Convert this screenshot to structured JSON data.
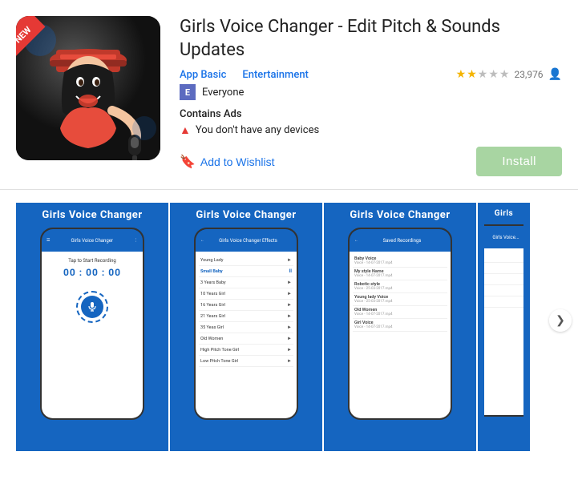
{
  "app": {
    "title": "Girls Voice Changer - Edit Pitch & Sounds Updates",
    "badge_new": "NEW",
    "category_primary": "App Basic",
    "category_secondary": "Entertainment",
    "rating_value": "2",
    "rating_count": "23,976",
    "rated": "Everyone",
    "rated_badge": "E",
    "contains_ads": "Contains Ads",
    "device_warning": "You don't have any devices",
    "add_wishlist": "Add to Wishlist",
    "install": "Install"
  },
  "screenshots": [
    {
      "title": "Girls Voice Changer",
      "type": "record",
      "tap_text": "Tap to Start Recording",
      "timer": "00 : 00 : 00",
      "nav_bar": "Girls Voice Changer"
    },
    {
      "title": "Girls Voice Changer",
      "type": "effects",
      "nav_bar": "Girls Voice Changer Effects",
      "effects": [
        {
          "name": "Young Lady",
          "play": "►"
        },
        {
          "name": "Small Baby",
          "play": "II",
          "highlighted": true
        },
        {
          "name": "3 Years Baby",
          "play": "►"
        },
        {
          "name": "10 Years Girl",
          "play": "►"
        },
        {
          "name": "16 Years Girl",
          "play": "►"
        },
        {
          "name": "21 Years Girl",
          "play": "►"
        },
        {
          "name": "35 Yeas Girl",
          "play": "►"
        },
        {
          "name": "Old Women",
          "play": "►"
        },
        {
          "name": "High Pitch Tone Girl",
          "play": "►"
        },
        {
          "name": "Low Pitch Tone Girl",
          "play": "►"
        }
      ]
    },
    {
      "title": "Girls Voice Changer",
      "type": "saved",
      "nav_bar": "Saved Recordings",
      "recordings": [
        {
          "name": "Baby Voice",
          "date": "Voice - 14-07-2017.mp4"
        },
        {
          "name": "My style Name",
          "date": "Voice - 14-07-2017.mp4"
        },
        {
          "name": "Robotic style",
          "date": "Voice - 25-03-2017.mp4"
        },
        {
          "name": "Young lady Voice",
          "date": "Voice - 25-03-2017.mp4"
        },
        {
          "name": "Old Women",
          "date": "Voice - 14-07-2017.mp4"
        },
        {
          "name": "Girl Voice",
          "date": "Voice - 14-07-2017.mp4"
        }
      ]
    },
    {
      "title": "Girls",
      "type": "partial"
    }
  ],
  "icons": {
    "star_filled": "★",
    "star_empty": "★",
    "user": "👤",
    "warning": "▲",
    "wishlist": "🔖",
    "mic": "🎤",
    "play": "►",
    "pause": "II",
    "back_arrow": "←",
    "chevron_right": "❯",
    "menu": "☰",
    "more": "⋮"
  },
  "colors": {
    "accent_blue": "#1565c0",
    "link_blue": "#1a73e8",
    "install_green": "#a8d5a2",
    "rating_gold": "#f4b400",
    "warning_red": "#e53935",
    "badge_red": "#e53935",
    "rated_purple": "#5c6bc0"
  }
}
